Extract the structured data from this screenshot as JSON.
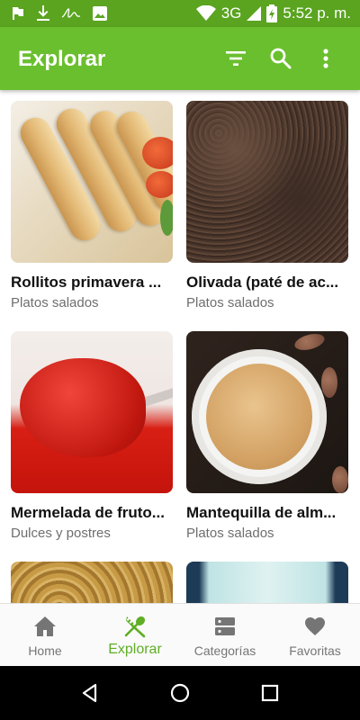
{
  "status_bar": {
    "network": "3G",
    "time": "5:52 p. m.",
    "icons": [
      "flag-icon",
      "download-icon",
      "signature-icon",
      "image-icon",
      "wifi-icon",
      "signal-icon",
      "battery-icon"
    ]
  },
  "app_bar": {
    "title": "Explorar",
    "actions": [
      "filter-icon",
      "search-icon",
      "more-vert-icon"
    ],
    "color": "#6abf2e"
  },
  "recipes": [
    {
      "title": "Rollitos primavera ...",
      "category": "Platos salados"
    },
    {
      "title": "Olivada (paté de ac...",
      "category": "Platos salados"
    },
    {
      "title": "Mermelada de fruto...",
      "category": "Dulces y postres"
    },
    {
      "title": "Mantequilla de alm...",
      "category": "Platos salados"
    }
  ],
  "bottom_nav": {
    "items": [
      {
        "label": "Home",
        "icon": "home-icon",
        "active": false
      },
      {
        "label": "Explorar",
        "icon": "fork-spoon-icon",
        "active": true
      },
      {
        "label": "Categorías",
        "icon": "categories-icon",
        "active": false
      },
      {
        "label": "Favoritas",
        "icon": "heart-icon",
        "active": false
      }
    ],
    "active_color": "#5fae25",
    "inactive_color": "#757575"
  },
  "system_nav": [
    "back-icon",
    "home-circle-icon",
    "recents-icon"
  ]
}
